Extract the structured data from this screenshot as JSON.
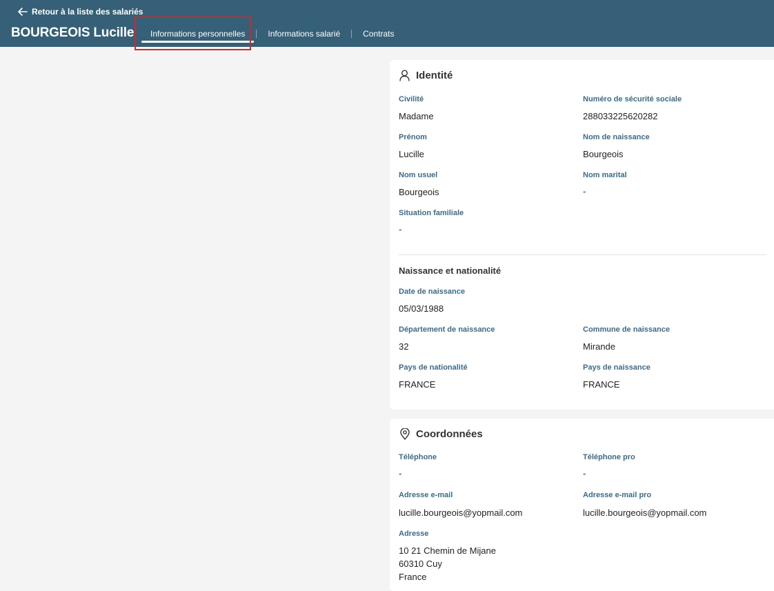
{
  "header": {
    "back_label": "Retour à la liste des salariés",
    "employee_name": "BOURGEOIS Lucille",
    "tabs": [
      {
        "label": "Informations personnelles",
        "active": true
      },
      {
        "label": "Informations salarié",
        "active": false
      },
      {
        "label": "Contrats",
        "active": false
      }
    ]
  },
  "identite": {
    "title": "Identité",
    "icon": "person-icon",
    "fields": {
      "civilite": {
        "label": "Civilité",
        "value": "Madame"
      },
      "nss": {
        "label": "Numéro de sécurité sociale",
        "value": "288033225620282"
      },
      "prenom": {
        "label": "Prénom",
        "value": "Lucille"
      },
      "nom_naissance": {
        "label": "Nom de naissance",
        "value": "Bourgeois"
      },
      "nom_usuel": {
        "label": "Nom usuel",
        "value": "Bourgeois"
      },
      "nom_marital": {
        "label": "Nom marital",
        "value": "-"
      },
      "situation_familiale": {
        "label": "Situation familiale",
        "value": "-"
      }
    }
  },
  "naissance": {
    "title": "Naissance et nationalité",
    "fields": {
      "date_naissance": {
        "label": "Date de naissance",
        "value": "05/03/1988"
      },
      "departement": {
        "label": "Département de naissance",
        "value": "32"
      },
      "commune": {
        "label": "Commune de naissance",
        "value": "Mirande"
      },
      "pays_nationalite": {
        "label": "Pays de nationalité",
        "value": "FRANCE"
      },
      "pays_naissance": {
        "label": "Pays de naissance",
        "value": "FRANCE"
      }
    }
  },
  "coordonnees": {
    "title": "Coordonnées",
    "icon": "location-pin-icon",
    "fields": {
      "telephone": {
        "label": "Téléphone",
        "value": "-"
      },
      "telephone_pro": {
        "label": "Téléphone pro",
        "value": "-"
      },
      "email": {
        "label": "Adresse e-mail",
        "value": "lucille.bourgeois@yopmail.com"
      },
      "email_pro": {
        "label": "Adresse e-mail pro",
        "value": "lucille.bourgeois@yopmail.com"
      },
      "adresse": {
        "label": "Adresse",
        "lines": [
          "10 21 Chemin de Mijane",
          "60310 Cuy",
          "France"
        ]
      }
    }
  },
  "colors": {
    "header_bg": "#356077",
    "label": "#3d6a85",
    "highlight": "#d92424"
  }
}
